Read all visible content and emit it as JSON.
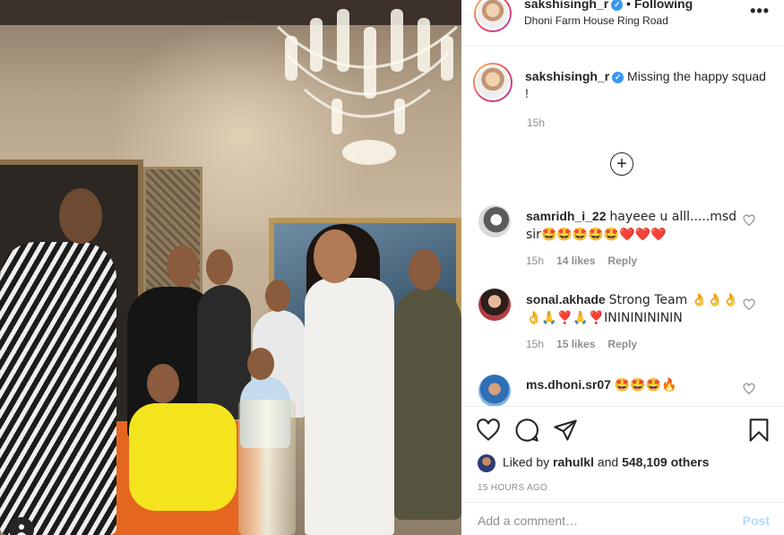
{
  "post": {
    "author": "sakshisingh_r",
    "verified_mark": "✓",
    "follow_status": "• Following",
    "location": "Dhoni Farm House Ring Road",
    "more_label": "•••"
  },
  "caption": {
    "username": "sakshisingh_r",
    "verified_mark": "✓",
    "text": "Missing the happy squad !",
    "time": "15h"
  },
  "load_more_label": "+",
  "comments": [
    {
      "username": "samridh_i_22",
      "text": "hayeee u alll.....msd sir🤩🤩🤩🤩🤩❤️❤️❤️",
      "time": "15h",
      "likes": "14 likes",
      "reply": "Reply"
    },
    {
      "username": "sonal.akhade",
      "text": "Strong Team 👌👌👌👌🙏❣️🙏❣️ININININININ",
      "time": "15h",
      "likes": "15 likes",
      "reply": "Reply"
    },
    {
      "username": "ms.dhoni.sr07",
      "text": "🤩🤩🤩🔥"
    }
  ],
  "actions": {
    "liked_by_prefix": "Liked by",
    "liked_by_user": "rahulkl",
    "liked_by_and": "and",
    "liked_by_count": "548,109 others",
    "posted_ago": "15 HOURS AGO"
  },
  "comment_box": {
    "placeholder": "Add a comment…",
    "post_label": "Post"
  },
  "icons": {
    "like": "heart-icon",
    "comment": "comment-icon",
    "share": "share-icon",
    "save": "bookmark-icon",
    "tag": "user-tag-icon"
  },
  "colors": {
    "link_blue": "#3897f0",
    "post_button_disabled": "#b3dbff",
    "muted_text": "#8e8e8e"
  }
}
